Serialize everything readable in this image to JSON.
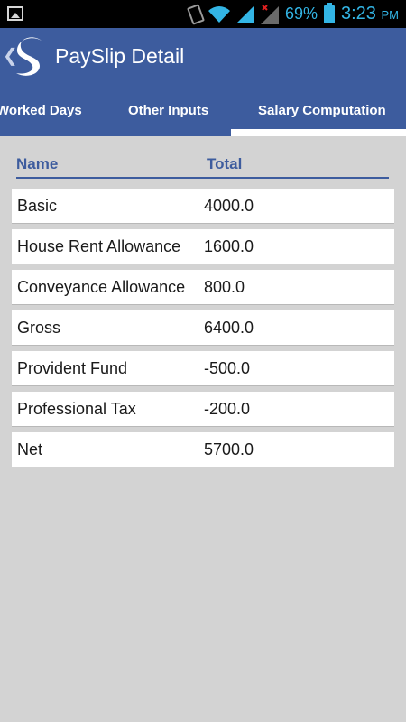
{
  "status_bar": {
    "battery_percent": "69%",
    "time": "3:23",
    "ampm": "PM",
    "icons": [
      "image-icon",
      "vibrate-icon",
      "wifi-icon",
      "signal-icon",
      "signal-x-icon",
      "battery-icon"
    ]
  },
  "header": {
    "title": "PaySlip Detail",
    "back_icon": "chevron-left-icon",
    "logo_icon": "app-logo-s-icon",
    "colors": {
      "primary": "#3d5c9e",
      "background": "#d3d3d3",
      "status_accent": "#33b5e5"
    }
  },
  "tabs": [
    {
      "label": "Worked Days",
      "selected": false
    },
    {
      "label": "Other Inputs",
      "selected": false
    },
    {
      "label": "Salary Computation",
      "selected": true
    }
  ],
  "table": {
    "columns": [
      "Name",
      "Total"
    ],
    "rows": [
      {
        "name": "Basic",
        "total": "4000.0"
      },
      {
        "name": "House Rent Allowance",
        "total": "1600.0"
      },
      {
        "name": "Conveyance Allowance",
        "total": "800.0"
      },
      {
        "name": "Gross",
        "total": "6400.0"
      },
      {
        "name": "Provident Fund",
        "total": "-500.0"
      },
      {
        "name": "Professional Tax",
        "total": "-200.0"
      },
      {
        "name": "Net",
        "total": "5700.0"
      }
    ]
  }
}
